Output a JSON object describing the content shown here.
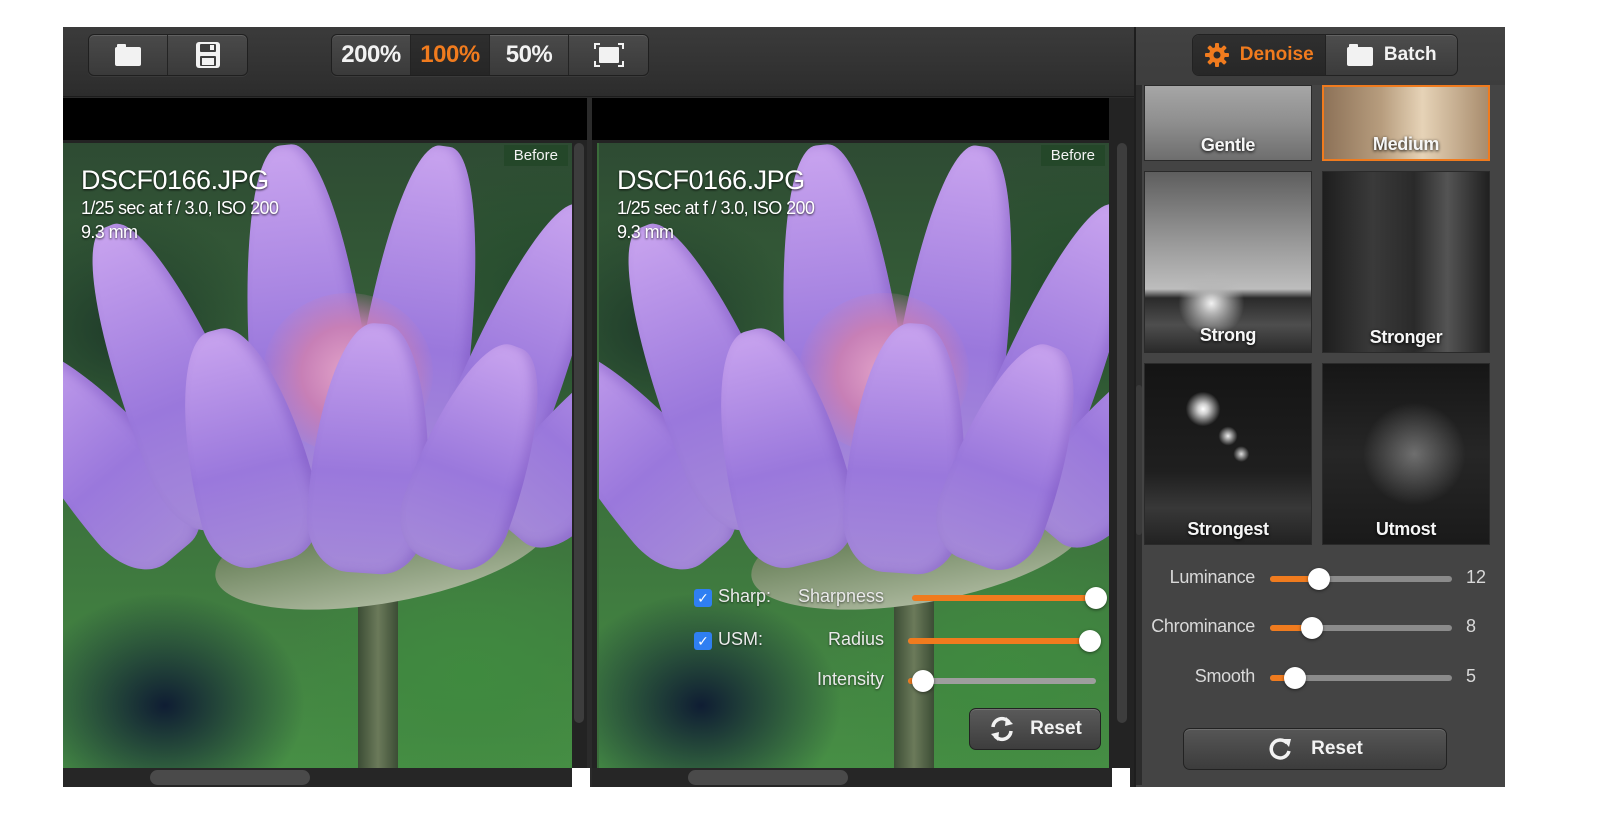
{
  "toolbar": {
    "file_buttons": [
      {
        "icon": "folder-icon",
        "label": "Open"
      },
      {
        "icon": "save-icon",
        "label": "Save"
      }
    ],
    "zoom_levels": [
      "200%",
      "100%",
      "50%"
    ],
    "active_zoom": "100%",
    "fit_icon": "fit-to-screen-icon"
  },
  "viewers": [
    {
      "id": "before",
      "tag": "Before",
      "filename": "DSCF0166.JPG",
      "exposure": "1/25 sec at f / 3.0, ISO 200",
      "focal_length": "9.3 mm"
    },
    {
      "id": "after",
      "tag": "Before",
      "filename": "DSCF0166.JPG",
      "exposure": "1/25 sec at f / 3.0, ISO 200",
      "focal_length": "9.3 mm"
    }
  ],
  "sharpen": {
    "rows": [
      {
        "checkbox_label": "Sharp:",
        "checked": true,
        "slider_label": "Sharpness",
        "value_fraction": 0.98
      },
      {
        "checkbox_label": "USM:",
        "checked": true,
        "slider_label": "Radius",
        "value_fraction": 0.97
      },
      {
        "checkbox_label": "",
        "checked": null,
        "slider_label": "Intensity",
        "value_fraction": 0.08
      }
    ],
    "reset_label": "Reset",
    "checkmark": "✓"
  },
  "panel": {
    "modes": [
      {
        "label": "Denoise",
        "icon": "gear-icon",
        "active": true
      },
      {
        "label": "Batch",
        "icon": "folder-icon",
        "active": false
      }
    ],
    "presets": [
      {
        "label": "Gentle",
        "selected": false
      },
      {
        "label": "Medium",
        "selected": true
      },
      {
        "label": "Strong",
        "selected": false
      },
      {
        "label": "Stronger",
        "selected": false
      },
      {
        "label": "Strongest",
        "selected": false
      },
      {
        "label": "Utmost",
        "selected": false
      }
    ],
    "sliders": [
      {
        "label": "Luminance",
        "value": "12",
        "value_fraction": 0.27
      },
      {
        "label": "Chrominance",
        "value": "8",
        "value_fraction": 0.23
      },
      {
        "label": "Smooth",
        "value": "5",
        "value_fraction": 0.14
      }
    ],
    "reset_label": "Reset"
  },
  "colors": {
    "accent": "#f07b1e",
    "checkbox": "#2f7ff2",
    "panel_bg": "#444444",
    "toolbar_bg": "#333333"
  }
}
